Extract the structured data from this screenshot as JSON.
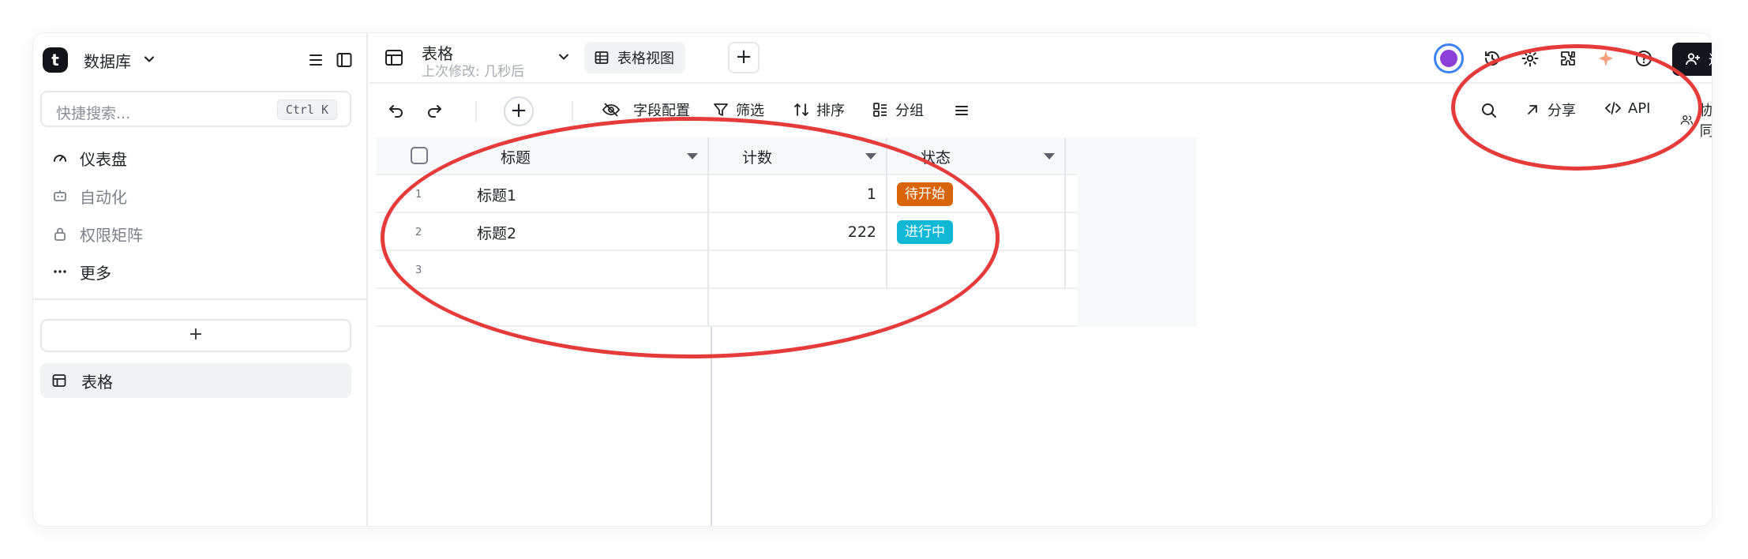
{
  "sidebar": {
    "logo_letter": "t",
    "db_title": "数据库",
    "search_placeholder": "快捷搜索...",
    "shortcut": "Ctrl K",
    "nav": [
      {
        "label": "仪表盘"
      },
      {
        "label": "自动化"
      },
      {
        "label": "权限矩阵"
      },
      {
        "label": "更多"
      }
    ],
    "add_label": "+",
    "table_item": "表格"
  },
  "topbar": {
    "table_name": "表格",
    "last_modified": "上次修改:  几秒后",
    "view_tab": "表格视图",
    "add_view": "+",
    "invite": "邀请"
  },
  "toolbar": {
    "fields": "字段配置",
    "filter": "筛选",
    "sort": "排序",
    "group": "分组",
    "share": "分享",
    "api": "API",
    "collab": "协同"
  },
  "grid": {
    "columns": [
      "标题",
      "计数",
      "状态"
    ],
    "rows": [
      {
        "num": "1",
        "title": "标题1",
        "count": "1",
        "status": "待开始",
        "status_color": "#d9650b"
      },
      {
        "num": "2",
        "title": "标题2",
        "count": "222",
        "status": "进行中",
        "status_color": "#10b8d6"
      },
      {
        "num": "3",
        "title": "",
        "count": "",
        "status": "",
        "status_color": ""
      }
    ]
  },
  "colors": {
    "accent_dark": "#14161c",
    "annotation": "#e63b3b"
  }
}
